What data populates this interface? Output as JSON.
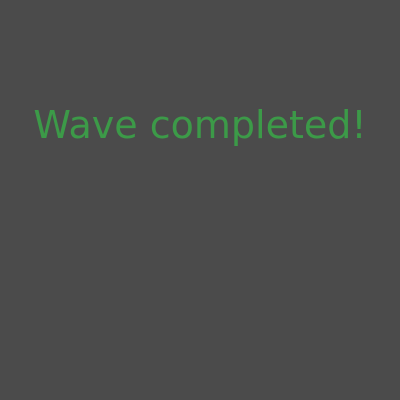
{
  "screen": {
    "message": "Wave completed!"
  },
  "colors": {
    "background": "#4b4b4b",
    "message_text": "#3c9a48"
  }
}
